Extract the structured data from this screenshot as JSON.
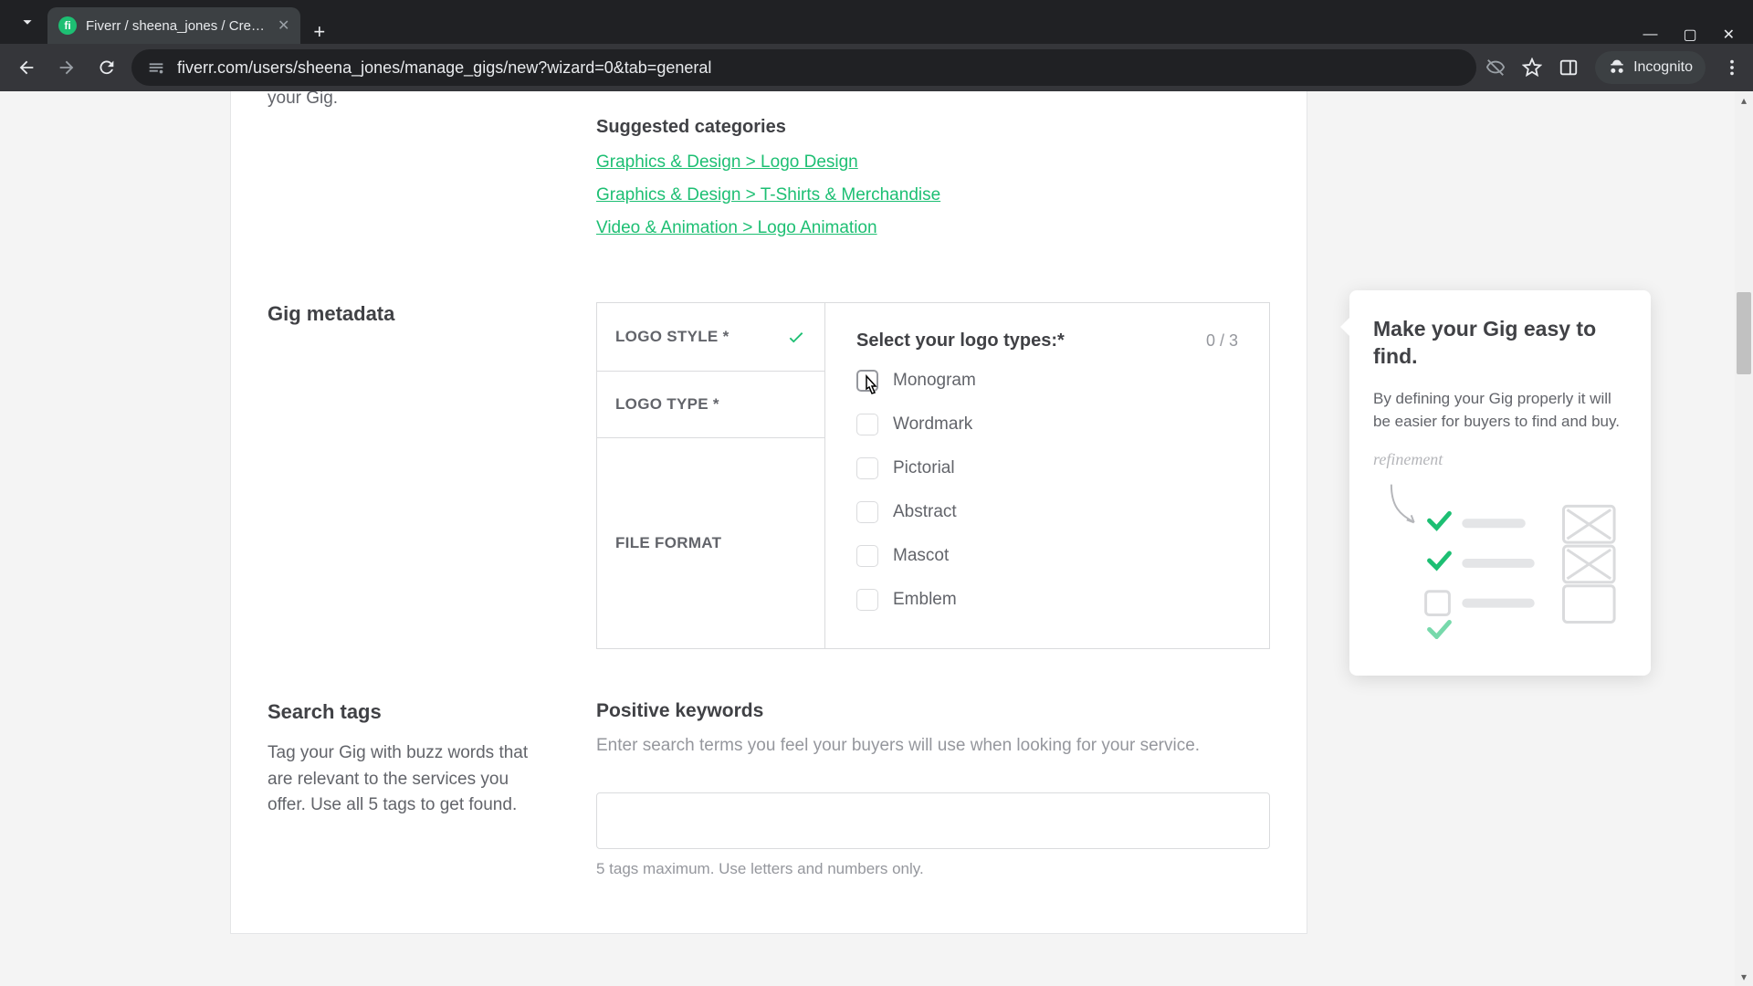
{
  "browser": {
    "tab_title": "Fiverr / sheena_jones / Create a",
    "url": "fiverr.com/users/sheena_jones/manage_gigs/new?wizard=0&tab=general",
    "incognito_label": "Incognito"
  },
  "page": {
    "cut_text": "your Gig.",
    "suggested": {
      "heading": "Suggested categories",
      "links": [
        "Graphics & Design > Logo Design",
        "Graphics & Design > T-Shirts & Merchandise",
        "Video & Animation > Logo Animation"
      ]
    },
    "metadata": {
      "section_title": "Gig metadata",
      "tabs": {
        "logo_style": "LOGO STYLE *",
        "logo_type": "LOGO TYPE *",
        "file_format": "FILE FORMAT"
      },
      "detail": {
        "title": "Select your logo types:*",
        "count": "0 / 3",
        "options": {
          "monogram": "Monogram",
          "wordmark": "Wordmark",
          "pictorial": "Pictorial",
          "abstract": "Abstract",
          "mascot": "Mascot",
          "emblem": "Emblem"
        }
      }
    },
    "tags": {
      "section_title": "Search tags",
      "section_desc": "Tag your Gig with buzz words that are relevant to the services you offer. Use all 5 tags to get found.",
      "field_label": "Positive keywords",
      "field_desc": "Enter search terms you feel your buyers will use when looking for your service.",
      "hint": "5 tags maximum. Use letters and numbers only."
    },
    "tip": {
      "title": "Make your Gig easy to find.",
      "desc": "By defining your Gig properly it will be easier for buyers to find and buy.",
      "refine": "refinement"
    }
  },
  "colors": {
    "accent": "#1dbf73"
  }
}
